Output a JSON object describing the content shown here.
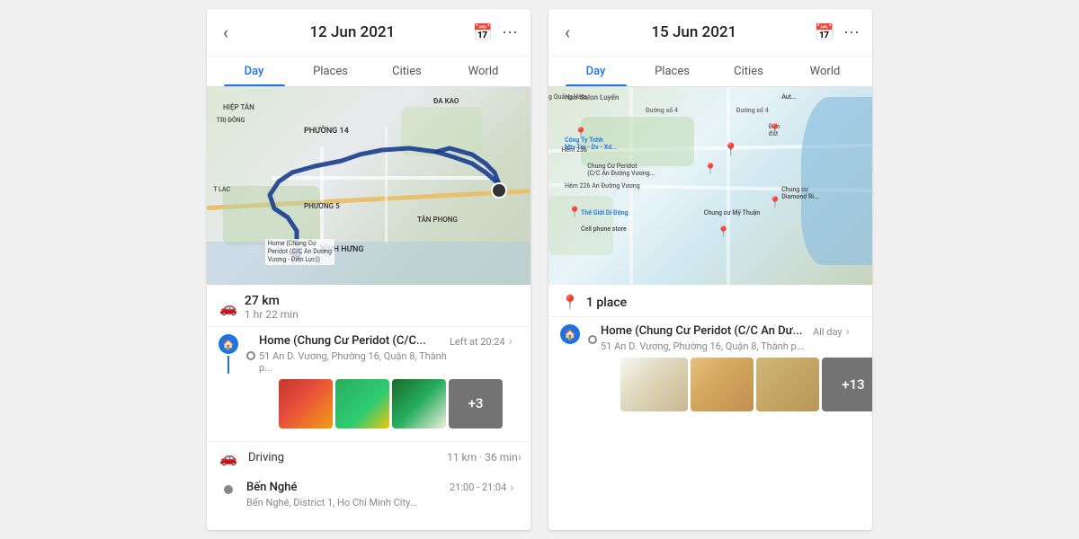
{
  "left_panel": {
    "date": "12 Jun 2021",
    "tabs": [
      "Day",
      "Places",
      "Cities",
      "World"
    ],
    "active_tab": "Day",
    "stats": {
      "distance": "27 km",
      "duration": "1 hr 22 min",
      "icon": "🚗"
    },
    "timeline": [
      {
        "type": "home",
        "title": "Home (Chung Cư Peridot (C/C...",
        "subtitle": "51 An D. Vương, Phường 16, Quận 8, Thành p...",
        "time": "Left at 20:24",
        "has_photos": true,
        "photo_more": "+3"
      },
      {
        "type": "driving",
        "label": "Driving",
        "distance": "11 km · 36 min"
      },
      {
        "type": "stop",
        "title": "Bến Nghé",
        "subtitle": "Bến Nghé, District 1, Ho Chi Minh City...",
        "time": "21:00 - 21:04"
      }
    ]
  },
  "right_panel": {
    "date": "15 Jun 2021",
    "tabs": [
      "Day",
      "Places",
      "Cities",
      "World"
    ],
    "active_tab": "Day",
    "stats": {
      "places": "1 place",
      "icon": "📍"
    },
    "timeline": [
      {
        "type": "home",
        "title": "Home (Chung Cư Peridot (C/C An Dư...",
        "subtitle": "51 An D. Vương, Phường 16, Quận 8, Thành p...",
        "time": "All day",
        "has_photos": true,
        "photo_more": "+13"
      }
    ]
  },
  "icons": {
    "back": "‹",
    "calendar": "📅",
    "more": "⋯",
    "home": "🏠",
    "car": "🚗",
    "pin": "📍",
    "chevron": "›"
  }
}
